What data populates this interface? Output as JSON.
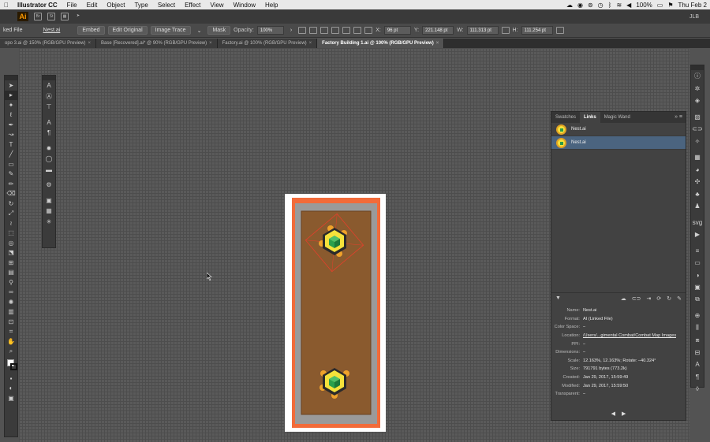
{
  "menubar": {
    "apple": "",
    "app_name": "Illustrator CC",
    "items": [
      "File",
      "Edit",
      "Object",
      "Type",
      "Select",
      "Effect",
      "View",
      "Window",
      "Help"
    ],
    "battery": "100%",
    "clock": "Thu Feb 2"
  },
  "appbar": {
    "logo": "Ai",
    "icons": [
      "Br",
      "St"
    ],
    "user": "JLB"
  },
  "control": {
    "linked_file": "ked File",
    "file_name": "Nest.ai",
    "embed": "Embed",
    "edit_original": "Edit Original",
    "image_trace": "Image Trace",
    "mask": "Mask",
    "opacity_label": "Opacity:",
    "opacity_value": "100%",
    "x_label": "X:",
    "x_value": "96 pt",
    "y_label": "Y:",
    "y_value": "221.148 pt",
    "w_label": "W:",
    "w_value": "111.313 pt",
    "h_label": "H:",
    "h_value": "111.254 pt"
  },
  "tabs": [
    {
      "label": "opo 3.ai @ 150% (RGB/GPU Preview)",
      "active": false
    },
    {
      "label": "Base [Recovered].ai* @ 90% (RGB/GPU Preview)",
      "active": false
    },
    {
      "label": "Factory.ai @ 100% (RGB/GPU Preview)",
      "active": false
    },
    {
      "label": "Factory Building 1.ai @ 100% (RGB/GPU Preview)",
      "active": true
    }
  ],
  "tab_close": "×",
  "panel": {
    "tabs": [
      "Swatches",
      "Links",
      "Magic Wand"
    ],
    "active_tab": "Links",
    "menu": "»  ≡",
    "links": [
      {
        "name": "Nest.ai",
        "selected": false
      },
      {
        "name": "Nest.ai",
        "selected": true
      }
    ],
    "info": [
      {
        "k": "Name:",
        "v": "Nest.ai"
      },
      {
        "k": "Format:",
        "v": "AI (Linked File)"
      },
      {
        "k": "Color Space:",
        "v": "–"
      },
      {
        "k": "Location:",
        "v": "/Users/...gimental Combat/Combat Map Images"
      },
      {
        "k": "PPI:",
        "v": "–"
      },
      {
        "k": "Dimensions:",
        "v": "–"
      },
      {
        "k": "Scale:",
        "v": "12.163%, 12.163%; Rotate: –40.324°"
      },
      {
        "k": "Size:",
        "v": "791791 bytes (773.2k)"
      },
      {
        "k": "Created:",
        "v": "Jan 29, 2017, 15:59:49"
      },
      {
        "k": "Modified:",
        "v": "Jan 29, 2017, 15:59:50"
      },
      {
        "k": "Transparent:",
        "v": "–"
      }
    ],
    "nav_prev": "◀",
    "nav_next": "▶"
  },
  "colors": {
    "artboard_border": "#f26b3a",
    "gray_frame": "#9a9a9a",
    "brown_fill": "#8a5a2e",
    "hex_yellow": "#f5e23b",
    "hex_dark": "#2b2b2b",
    "cube_green": "#2aa04c",
    "node_orange": "#f0a22a"
  }
}
